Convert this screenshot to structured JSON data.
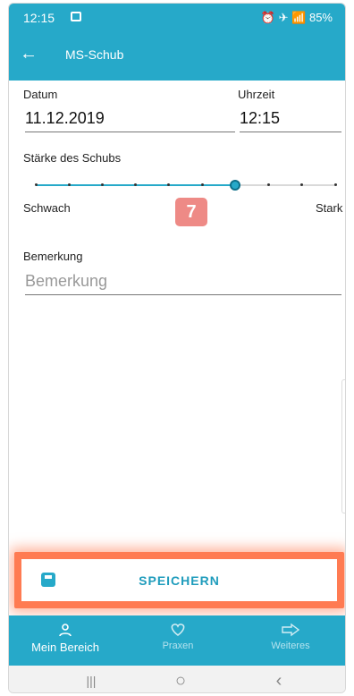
{
  "status_bar": {
    "time": "12:15",
    "right_status": "⏰ ✈ 📶 85%"
  },
  "app_bar": {
    "back_icon": "←",
    "title": "MS-Schub"
  },
  "form": {
    "date_label": "Datum",
    "date_value": "11.12.2019",
    "time_label": "Uhrzeit",
    "time_value": "12:15",
    "strength_label": "Stärke des Schubs",
    "slider": {
      "min": 1,
      "max": 10,
      "value": 7,
      "min_label": "Schwach",
      "max_label": "Stark",
      "value_label": "7"
    },
    "note_label": "Bemerkung",
    "note_placeholder": "Bemerkung"
  },
  "save_button": {
    "label": "SPEICHERN"
  },
  "bottom_nav": [
    {
      "label": "Mein Bereich",
      "icon": "person-icon",
      "active": true
    },
    {
      "label": "Praxen",
      "icon": "heart-icon",
      "active": false
    },
    {
      "label": "Weiteres",
      "icon": "arrow-right-icon",
      "active": false
    }
  ],
  "system_nav": {
    "recent_icon": "|||",
    "home_icon": "○",
    "back_icon": "‹"
  },
  "colors": {
    "primary": "#26a9c9",
    "badge": "#ee8a86",
    "highlight": "#ff7b52"
  }
}
